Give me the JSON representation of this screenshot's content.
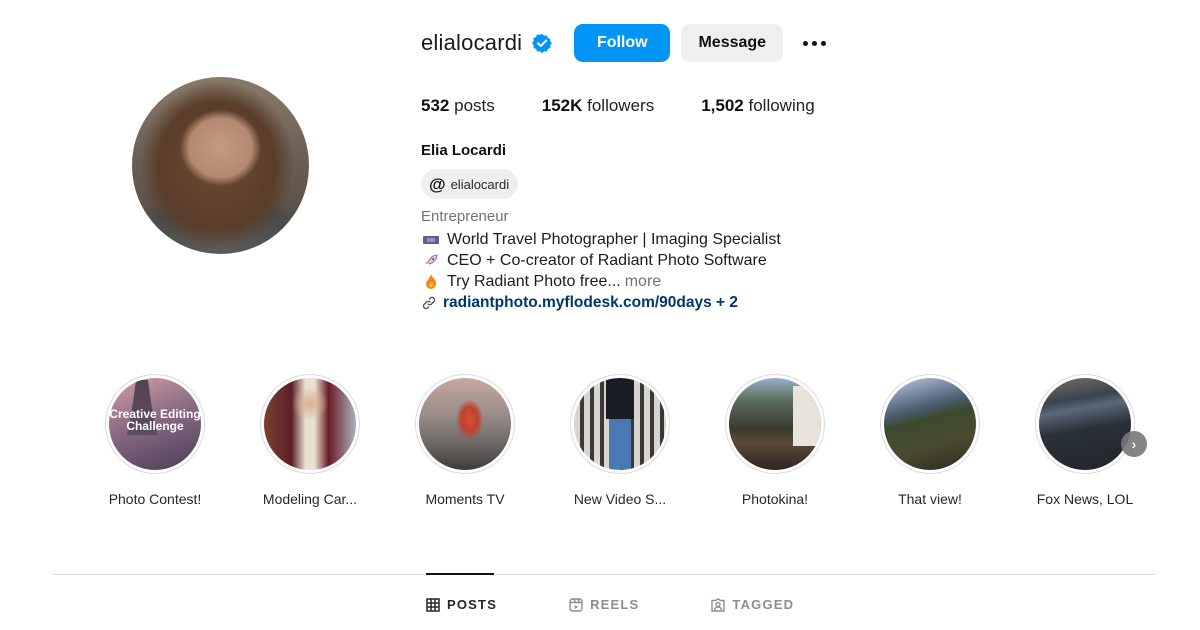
{
  "profile": {
    "username": "elialocardi",
    "verified": true,
    "full_name": "Elia Locardi",
    "threads_handle": "elialocardi",
    "category": "Entrepreneur",
    "accent_color": "#0095f6"
  },
  "actions": {
    "follow_label": "Follow",
    "message_label": "Message",
    "more_icon": "more-horizontal-icon"
  },
  "stats": {
    "posts_count": "532",
    "posts_label": "posts",
    "followers_count": "152K",
    "followers_label": "followers",
    "following_count": "1,502",
    "following_label": "following"
  },
  "bio": {
    "lines": [
      {
        "icon": "camera-emoji",
        "text": "World Travel Photographer | Imaging Specialist"
      },
      {
        "icon": "rocket-emoji",
        "text": "CEO + Co-creator of Radiant Photo Software"
      },
      {
        "icon": "fire-emoji",
        "text": "Try Radiant Photo free..."
      }
    ],
    "more_label": "more",
    "link_text": "radiantphoto.myflodesk.com/90days + 2"
  },
  "highlights": [
    {
      "label": "Photo Contest!",
      "overlay": "Creative Editing Challenge"
    },
    {
      "label": "Modeling Car...",
      "overlay": ""
    },
    {
      "label": "Moments TV",
      "overlay": ""
    },
    {
      "label": "New Video S...",
      "overlay": ""
    },
    {
      "label": "Photokina!",
      "overlay": ""
    },
    {
      "label": "That view!",
      "overlay": ""
    },
    {
      "label": "Fox News, LOL",
      "overlay": ""
    }
  ],
  "tabs": [
    {
      "label": "POSTS",
      "active": true
    },
    {
      "label": "REELS",
      "active": false
    },
    {
      "label": "TAGGED",
      "active": false
    }
  ]
}
